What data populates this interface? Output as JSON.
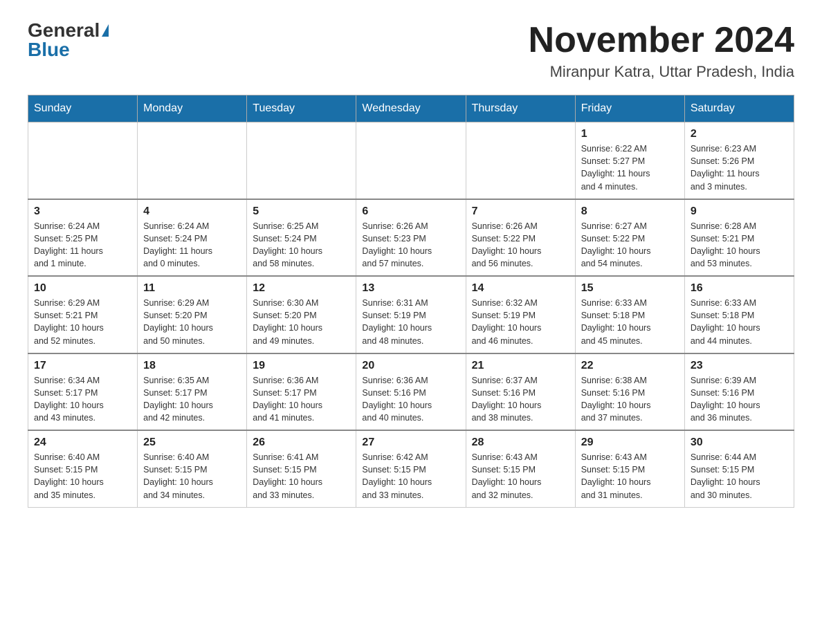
{
  "header": {
    "logo_general": "General",
    "logo_blue": "Blue",
    "month_year": "November 2024",
    "location": "Miranpur Katra, Uttar Pradesh, India"
  },
  "weekdays": [
    "Sunday",
    "Monday",
    "Tuesday",
    "Wednesday",
    "Thursday",
    "Friday",
    "Saturday"
  ],
  "weeks": [
    [
      {
        "day": "",
        "info": ""
      },
      {
        "day": "",
        "info": ""
      },
      {
        "day": "",
        "info": ""
      },
      {
        "day": "",
        "info": ""
      },
      {
        "day": "",
        "info": ""
      },
      {
        "day": "1",
        "info": "Sunrise: 6:22 AM\nSunset: 5:27 PM\nDaylight: 11 hours\nand 4 minutes."
      },
      {
        "day": "2",
        "info": "Sunrise: 6:23 AM\nSunset: 5:26 PM\nDaylight: 11 hours\nand 3 minutes."
      }
    ],
    [
      {
        "day": "3",
        "info": "Sunrise: 6:24 AM\nSunset: 5:25 PM\nDaylight: 11 hours\nand 1 minute."
      },
      {
        "day": "4",
        "info": "Sunrise: 6:24 AM\nSunset: 5:24 PM\nDaylight: 11 hours\nand 0 minutes."
      },
      {
        "day": "5",
        "info": "Sunrise: 6:25 AM\nSunset: 5:24 PM\nDaylight: 10 hours\nand 58 minutes."
      },
      {
        "day": "6",
        "info": "Sunrise: 6:26 AM\nSunset: 5:23 PM\nDaylight: 10 hours\nand 57 minutes."
      },
      {
        "day": "7",
        "info": "Sunrise: 6:26 AM\nSunset: 5:22 PM\nDaylight: 10 hours\nand 56 minutes."
      },
      {
        "day": "8",
        "info": "Sunrise: 6:27 AM\nSunset: 5:22 PM\nDaylight: 10 hours\nand 54 minutes."
      },
      {
        "day": "9",
        "info": "Sunrise: 6:28 AM\nSunset: 5:21 PM\nDaylight: 10 hours\nand 53 minutes."
      }
    ],
    [
      {
        "day": "10",
        "info": "Sunrise: 6:29 AM\nSunset: 5:21 PM\nDaylight: 10 hours\nand 52 minutes."
      },
      {
        "day": "11",
        "info": "Sunrise: 6:29 AM\nSunset: 5:20 PM\nDaylight: 10 hours\nand 50 minutes."
      },
      {
        "day": "12",
        "info": "Sunrise: 6:30 AM\nSunset: 5:20 PM\nDaylight: 10 hours\nand 49 minutes."
      },
      {
        "day": "13",
        "info": "Sunrise: 6:31 AM\nSunset: 5:19 PM\nDaylight: 10 hours\nand 48 minutes."
      },
      {
        "day": "14",
        "info": "Sunrise: 6:32 AM\nSunset: 5:19 PM\nDaylight: 10 hours\nand 46 minutes."
      },
      {
        "day": "15",
        "info": "Sunrise: 6:33 AM\nSunset: 5:18 PM\nDaylight: 10 hours\nand 45 minutes."
      },
      {
        "day": "16",
        "info": "Sunrise: 6:33 AM\nSunset: 5:18 PM\nDaylight: 10 hours\nand 44 minutes."
      }
    ],
    [
      {
        "day": "17",
        "info": "Sunrise: 6:34 AM\nSunset: 5:17 PM\nDaylight: 10 hours\nand 43 minutes."
      },
      {
        "day": "18",
        "info": "Sunrise: 6:35 AM\nSunset: 5:17 PM\nDaylight: 10 hours\nand 42 minutes."
      },
      {
        "day": "19",
        "info": "Sunrise: 6:36 AM\nSunset: 5:17 PM\nDaylight: 10 hours\nand 41 minutes."
      },
      {
        "day": "20",
        "info": "Sunrise: 6:36 AM\nSunset: 5:16 PM\nDaylight: 10 hours\nand 40 minutes."
      },
      {
        "day": "21",
        "info": "Sunrise: 6:37 AM\nSunset: 5:16 PM\nDaylight: 10 hours\nand 38 minutes."
      },
      {
        "day": "22",
        "info": "Sunrise: 6:38 AM\nSunset: 5:16 PM\nDaylight: 10 hours\nand 37 minutes."
      },
      {
        "day": "23",
        "info": "Sunrise: 6:39 AM\nSunset: 5:16 PM\nDaylight: 10 hours\nand 36 minutes."
      }
    ],
    [
      {
        "day": "24",
        "info": "Sunrise: 6:40 AM\nSunset: 5:15 PM\nDaylight: 10 hours\nand 35 minutes."
      },
      {
        "day": "25",
        "info": "Sunrise: 6:40 AM\nSunset: 5:15 PM\nDaylight: 10 hours\nand 34 minutes."
      },
      {
        "day": "26",
        "info": "Sunrise: 6:41 AM\nSunset: 5:15 PM\nDaylight: 10 hours\nand 33 minutes."
      },
      {
        "day": "27",
        "info": "Sunrise: 6:42 AM\nSunset: 5:15 PM\nDaylight: 10 hours\nand 33 minutes."
      },
      {
        "day": "28",
        "info": "Sunrise: 6:43 AM\nSunset: 5:15 PM\nDaylight: 10 hours\nand 32 minutes."
      },
      {
        "day": "29",
        "info": "Sunrise: 6:43 AM\nSunset: 5:15 PM\nDaylight: 10 hours\nand 31 minutes."
      },
      {
        "day": "30",
        "info": "Sunrise: 6:44 AM\nSunset: 5:15 PM\nDaylight: 10 hours\nand 30 minutes."
      }
    ]
  ]
}
